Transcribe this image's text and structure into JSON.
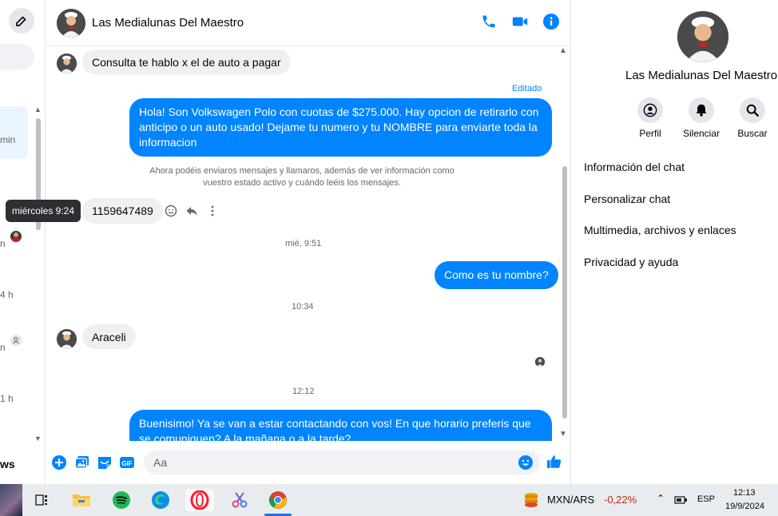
{
  "sidebar": {
    "times": [
      "min",
      "4 h",
      "1 h"
    ],
    "bottom_label": "ws"
  },
  "tooltip": {
    "text": "miércoles 9:24"
  },
  "header": {
    "title": "Las Medialunas Del Maestro"
  },
  "messages": {
    "in_1": "Consulta te hablo x el de auto a pagar",
    "edited_label": "Editado",
    "out_1": "Hola! Son Volkswagen Polo con cuotas de $275.000. Hay opcion de retirarlo con anticipo o un auto usado! Dejame tu numero y tu NOMBRE para enviarte toda la informacion",
    "system_notice": "Ahora podéis enviaros mensajes y llamaros, además de ver información como vuestro estado activo y cuándo leéis los mensajes.",
    "in_2": "1159647489",
    "ts_1": "mié, 9:51",
    "out_2": "Como es tu nombre?",
    "ts_2": "10:34",
    "in_3": "Araceli",
    "ts_3": "12:12",
    "out_3": "Buenisimo! Ya se van a estar contactando con vos! En que horario preferis que se comuniquen? A la mañana o a la tarde?"
  },
  "composer": {
    "placeholder": "Aa"
  },
  "right_panel": {
    "name": "Las Medialunas Del Maestro",
    "actions": [
      {
        "label": "Perfil",
        "icon": "profile-icon"
      },
      {
        "label": "Silenciar",
        "icon": "bell-icon"
      },
      {
        "label": "Buscar",
        "icon": "search-icon"
      }
    ],
    "menu": [
      "Información del chat",
      "Personalizar chat",
      "Multimedia, archivos y enlaces",
      "Privacidad y ayuda"
    ]
  },
  "taskbar": {
    "currency": "MXN/ARS",
    "change": "-0,22%",
    "lang": "ESP",
    "time": "12:13",
    "date": "19/9/2024"
  },
  "colors": {
    "accent": "#0084ff",
    "negative": "#c42b1c"
  }
}
